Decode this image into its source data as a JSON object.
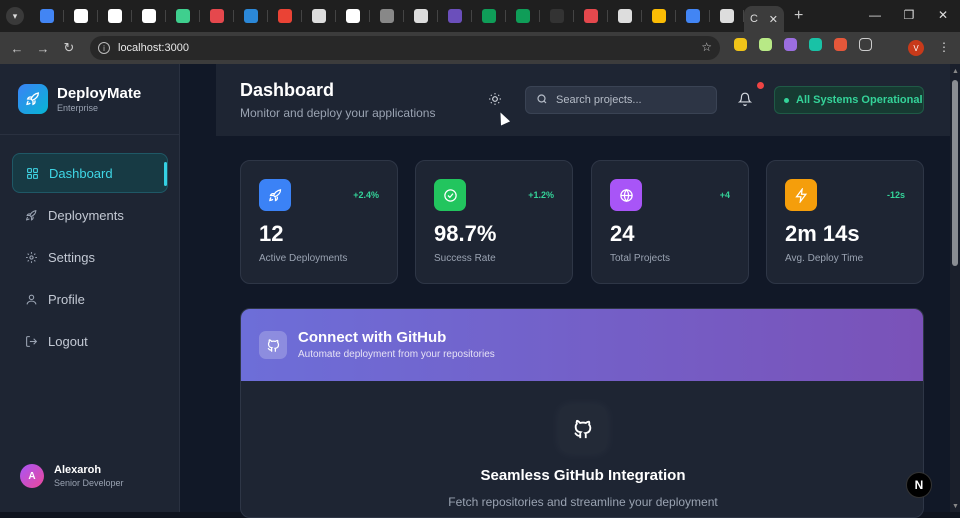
{
  "browser": {
    "tabs": [
      {
        "icon": "google-icon",
        "color": "#4285f4"
      },
      {
        "icon": "link-icon",
        "color": "#ffffff"
      },
      {
        "icon": "triangle-icon",
        "color": "#ffffff"
      },
      {
        "icon": "github-icon",
        "color": "#ffffff"
      },
      {
        "icon": "heart-icon",
        "color": "#3fcf8e"
      },
      {
        "icon": "blob-icon",
        "color": "#e5484d"
      },
      {
        "icon": "terminal-icon",
        "color": "#2b88d8"
      },
      {
        "icon": "gmail-icon",
        "color": "#ea4335"
      },
      {
        "icon": "openai-icon",
        "color": "#dddddd"
      },
      {
        "icon": "c-icon",
        "color": "#ffffff"
      },
      {
        "icon": "dots-icon",
        "color": "#888888"
      },
      {
        "icon": "person-icon",
        "color": "#dddddd"
      },
      {
        "icon": "list-icon",
        "color": "#6b4fbb"
      },
      {
        "icon": "sheets-icon",
        "color": "#0f9d58"
      },
      {
        "icon": "sheets-icon",
        "color": "#0f9d58"
      },
      {
        "icon": "circle-icon",
        "color": "#333333"
      },
      {
        "icon": "burst-icon",
        "color": "#e5484d"
      },
      {
        "icon": "globe-icon",
        "color": "#dddddd"
      },
      {
        "icon": "drive-icon",
        "color": "#fbbc04"
      },
      {
        "icon": "calendar-icon",
        "color": "#4285f4"
      },
      {
        "icon": "globe-icon",
        "color": "#dddddd"
      }
    ],
    "active_tab_label": "C",
    "url": "localhost:3000",
    "profile_initial": "V"
  },
  "sidebar": {
    "brand_name": "DeployMate",
    "brand_sub": "Enterprise",
    "items": [
      {
        "label": "Dashboard",
        "icon": "grid-icon",
        "active": true
      },
      {
        "label": "Deployments",
        "icon": "rocket-icon",
        "active": false
      },
      {
        "label": "Settings",
        "icon": "gear-icon",
        "active": false
      },
      {
        "label": "Profile",
        "icon": "user-icon",
        "active": false
      },
      {
        "label": "Logout",
        "icon": "logout-icon",
        "active": false
      }
    ],
    "user": {
      "initial": "A",
      "name": "Alexaroh",
      "role": "Senior Developer"
    }
  },
  "header": {
    "title": "Dashboard",
    "subtitle": "Monitor and deploy your applications",
    "search_placeholder": "Search projects...",
    "status_text": "All Systems Operational"
  },
  "stats": [
    {
      "value": "12",
      "label": "Active Deployments",
      "delta": "+2.4%",
      "icon": "rocket-icon",
      "color": "#3b82f6"
    },
    {
      "value": "98.7%",
      "label": "Success Rate",
      "delta": "+1.2%",
      "icon": "check-circle-icon",
      "color": "#22c55e"
    },
    {
      "value": "24",
      "label": "Total Projects",
      "delta": "+4",
      "icon": "globe-icon",
      "color": "#a855f7"
    },
    {
      "value": "2m 14s",
      "label": "Avg. Deploy Time",
      "delta": "-12s",
      "icon": "bolt-icon",
      "color": "#f59e0b"
    }
  ],
  "github": {
    "title": "Connect with GitHub",
    "subtitle": "Automate deployment from your repositories",
    "body_title": "Seamless GitHub Integration",
    "body_sub": "Fetch repositories and streamline your deployment"
  },
  "next_badge": "N",
  "colors": {
    "accent": "#3fd6e6",
    "success": "#34d399",
    "danger": "#ef4444"
  }
}
